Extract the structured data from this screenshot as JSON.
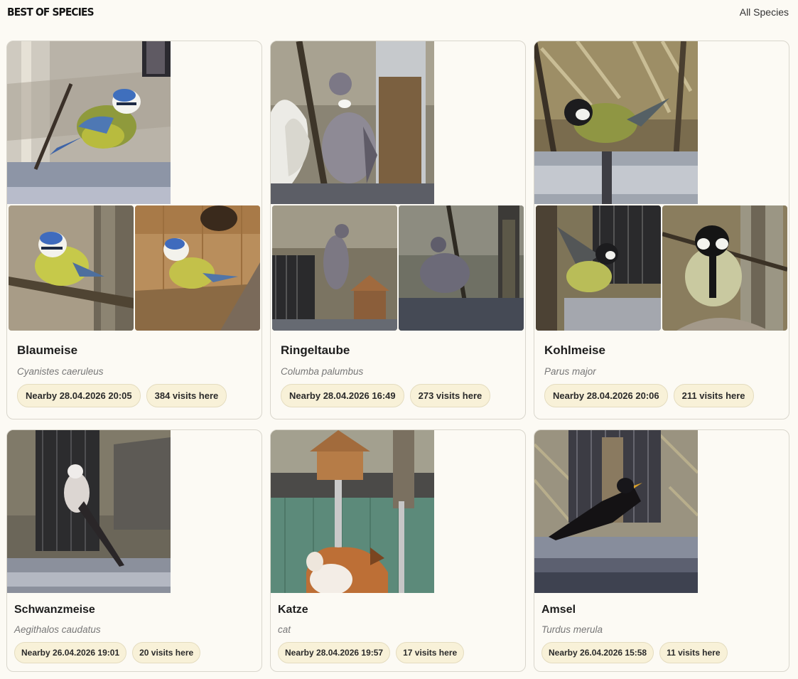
{
  "header": {
    "title": "BEST OF SPECIES",
    "all_link": "All Species"
  },
  "featured": [
    {
      "name": "Blaumeise",
      "latin": "Cyanistes caeruleus",
      "nearby": "Nearby 28.04.2026 20:05",
      "visits": "384 visits here"
    },
    {
      "name": "Ringeltaube",
      "latin": "Columba palumbus",
      "nearby": "Nearby 28.04.2026 16:49",
      "visits": "273 visits here"
    },
    {
      "name": "Kohlmeise",
      "latin": "Parus major",
      "nearby": "Nearby 28.04.2026 20:06",
      "visits": "211 visits here"
    }
  ],
  "more": [
    {
      "name": "Schwanzmeise",
      "latin": "Aegithalos caudatus",
      "nearby": "Nearby 26.04.2026 19:01",
      "visits": "20 visits here"
    },
    {
      "name": "Katze",
      "latin": "cat",
      "nearby": "Nearby 28.04.2026 19:57",
      "visits": "17 visits here"
    },
    {
      "name": "Amsel",
      "latin": "Turdus merula",
      "nearby": "Nearby 26.04.2026 15:58",
      "visits": "11 visits here"
    }
  ]
}
